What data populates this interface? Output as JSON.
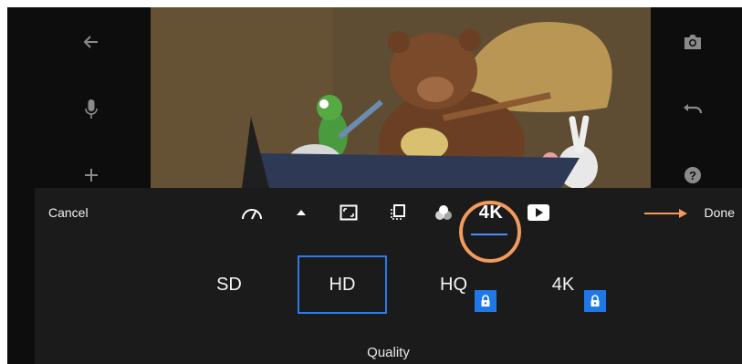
{
  "toolbar": {
    "cancel_label": "Cancel",
    "done_label": "Done",
    "tools": [
      {
        "name": "speed-icon"
      },
      {
        "name": "triangle-up-icon"
      },
      {
        "name": "aspect-ratio-icon"
      },
      {
        "name": "crop-frame-icon"
      },
      {
        "name": "filters-icon"
      },
      {
        "name": "4k-quality-icon",
        "label": "4K"
      },
      {
        "name": "play-icon"
      }
    ]
  },
  "quality": {
    "options": [
      {
        "label": "SD",
        "locked": false,
        "selected": false
      },
      {
        "label": "HD",
        "locked": false,
        "selected": true
      },
      {
        "label": "HQ",
        "locked": true,
        "selected": false
      },
      {
        "label": "4K",
        "locked": true,
        "selected": false
      }
    ],
    "title": "Quality"
  },
  "colors": {
    "accent": "#2e7be8",
    "highlight": "#f39a5c",
    "panel": "#1b1b1b"
  },
  "left_rail_icons": [
    "back-arrow-icon",
    "microphone-icon",
    "plus-icon"
  ],
  "right_rail_icons": [
    "camera-icon",
    "undo-icon",
    "help-icon"
  ]
}
